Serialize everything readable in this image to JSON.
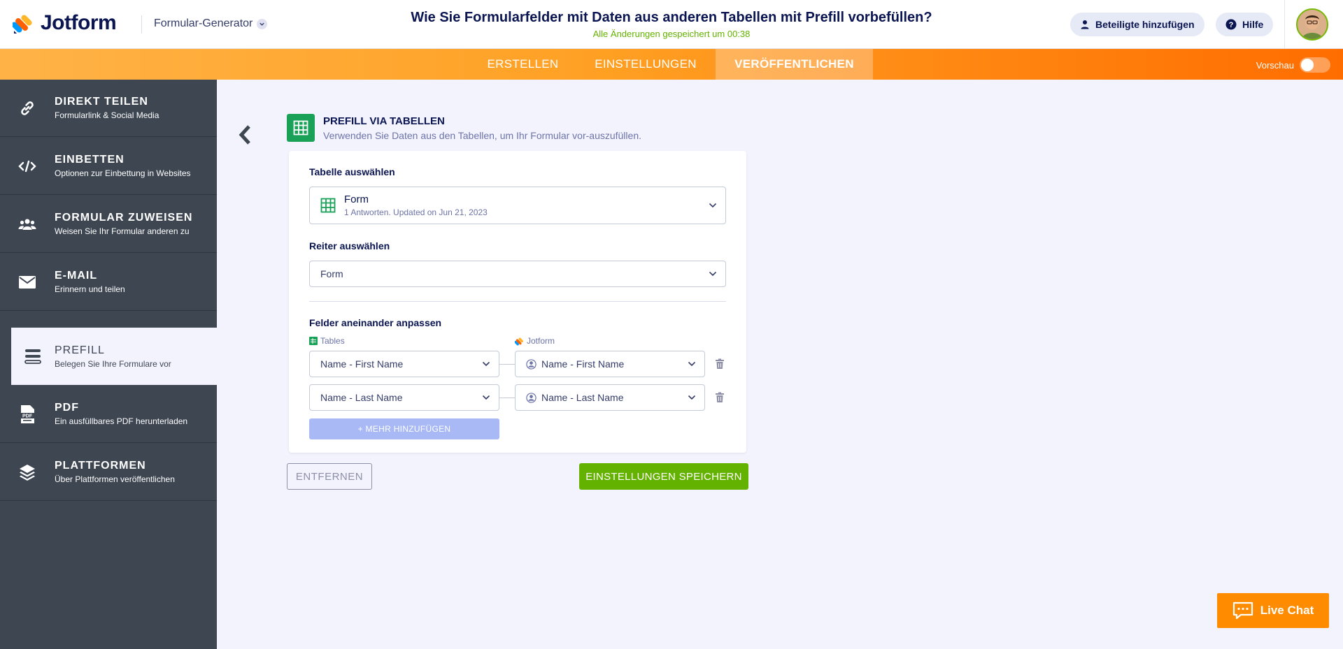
{
  "header": {
    "logo_text": "Jotform",
    "builder_switch": "Formular-Generator",
    "form_title": "Wie Sie Formularfelder mit Daten aus anderen Tabellen mit Prefill vorbefüllen?",
    "saved_status": "Alle Änderungen gespeichert um 00:38",
    "add_participants": "Beteiligte hinzufügen",
    "help": "Hilfe"
  },
  "nav": {
    "tabs": [
      "ERSTELLEN",
      "EINSTELLUNGEN",
      "VERÖFFENTLICHEN"
    ],
    "active_tab": "VERÖFFENTLICHEN",
    "preview_label": "Vorschau",
    "preview_on": false
  },
  "sidebar": {
    "items": [
      {
        "title": "DIREKT TEILEN",
        "subtitle": "Formularlink & Social Media",
        "icon": "link-icon"
      },
      {
        "title": "EINBETTEN",
        "subtitle": "Optionen zur Einbettung in Websites",
        "icon": "code-icon"
      },
      {
        "title": "FORMULAR ZUWEISEN",
        "subtitle": "Weisen Sie Ihr Formular anderen zu",
        "icon": "users-icon"
      },
      {
        "title": "E-MAIL",
        "subtitle": "Erinnern und teilen",
        "icon": "envelope-icon"
      },
      {
        "title": "PREFILL",
        "subtitle": "Belegen Sie Ihre Formulare vor",
        "icon": "prefill-icon"
      },
      {
        "title": "PDF",
        "subtitle": "Ein ausfüllbares PDF herunterladen",
        "icon": "pdf-icon"
      },
      {
        "title": "PLATTFORMEN",
        "subtitle": "Über Plattformen veröffentlichen",
        "icon": "layers-icon"
      }
    ],
    "active_index": 4
  },
  "main": {
    "section_title": "PREFILL VIA TABELLEN",
    "section_subtitle": "Verwenden Sie Daten aus den Tabellen, um Ihr Formular vor-auszufüllen.",
    "table_label": "Tabelle auswählen",
    "table_name": "Form",
    "table_meta": "1 Antworten. Updated on Jun 21, 2023",
    "tab_label": "Reiter auswählen",
    "tab_value": "Form",
    "match_label": "Felder aneinander anpassen",
    "col_tables": "Tables",
    "col_jotform": "Jotform",
    "mappings": [
      {
        "tables": "Name - First Name",
        "jotform": "Name - First Name"
      },
      {
        "tables": "Name - Last Name",
        "jotform": "Name - Last Name"
      }
    ],
    "add_more": "+ MEHR HINZUFÜGEN",
    "remove_button": "ENTFERNEN",
    "save_button": "EINSTELLUNGEN SPEICHERN"
  },
  "live_chat": "Live Chat",
  "colors": {
    "accent_orange": "#ff6d00",
    "success_green": "#64b200",
    "sidebar_bg": "#3e4652",
    "tables_green": "#18a157"
  }
}
